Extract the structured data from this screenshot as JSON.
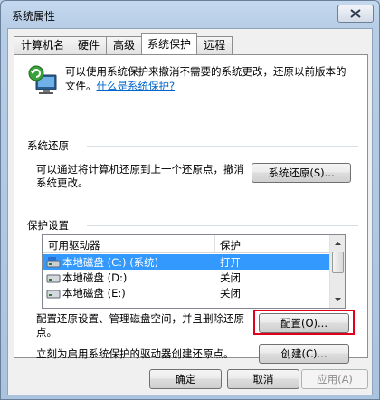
{
  "window": {
    "title": "系统属性"
  },
  "tabs": [
    {
      "label": "计算机名",
      "active": false
    },
    {
      "label": "硬件",
      "active": false
    },
    {
      "label": "高级",
      "active": false
    },
    {
      "label": "系统保护",
      "active": true
    },
    {
      "label": "远程",
      "active": false
    }
  ],
  "intro": {
    "text": "可以使用系统保护来撤消不需要的系统更改，还原以前版本的文件。",
    "link": "什么是系统保护?"
  },
  "restore": {
    "group_label": "系统还原",
    "description": "可以通过将计算机还原到上一个还原点，撤消系统更改。",
    "button": "系统还原(S)..."
  },
  "protection": {
    "group_label": "保护设置",
    "columns": [
      "可用驱动器",
      "保护"
    ],
    "drives": [
      {
        "name": "本地磁盘 (C:) (系统)",
        "protection": "打开",
        "selected": true,
        "icon": "system-drive-icon"
      },
      {
        "name": "本地磁盘 (D:)",
        "protection": "关闭",
        "selected": false,
        "icon": "drive-icon"
      },
      {
        "name": "本地磁盘 (E:)",
        "protection": "关闭",
        "selected": false,
        "icon": "drive-icon"
      }
    ],
    "configure_text": "配置还原设置、管理磁盘空间，并且删除还原点。",
    "configure_button": "配置(O)...",
    "create_text": "立刻为启用系统保护的驱动器创建还原点。",
    "create_button": "创建(C)..."
  },
  "footer": {
    "ok": "确定",
    "cancel": "取消",
    "apply": "应用(A)"
  },
  "colors": {
    "selection": "#3399ff",
    "link": "#0066cc",
    "highlight": "#e0001b"
  }
}
